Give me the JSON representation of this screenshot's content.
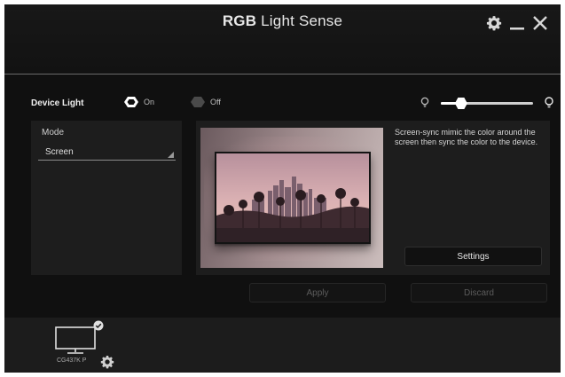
{
  "app": {
    "title_bold": "RGB",
    "title_rest": "Light Sense"
  },
  "window_controls": {
    "settings_icon": "gear-icon",
    "minimize_icon": "minimize-icon",
    "close_icon": "close-icon"
  },
  "device_light": {
    "label": "Device Light",
    "on_label": "On",
    "off_label": "Off",
    "selected": "On",
    "brightness": 0.22
  },
  "mode": {
    "label": "Mode",
    "value": "Screen"
  },
  "screen_sync": {
    "description": "Screen-sync mimic the color around the screen then sync the color to the device.",
    "settings_label": "Settings"
  },
  "actions": {
    "apply_label": "Apply",
    "discard_label": "Discard"
  },
  "device": {
    "name": "CG437K P",
    "connected": true
  },
  "colors": {
    "background": "#101010",
    "panel": "#1d1d1d",
    "accent": "#ffffff"
  }
}
